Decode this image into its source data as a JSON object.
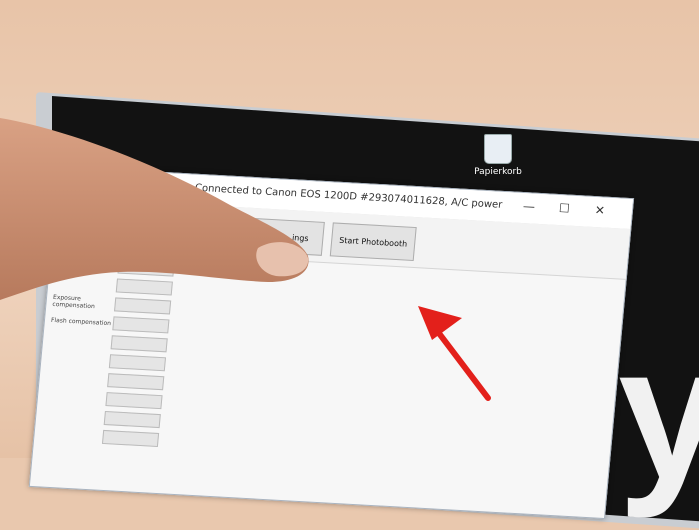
{
  "desktop": {
    "recycle_bin_label": "Papierkorb",
    "wallpaper_letter": "y"
  },
  "window": {
    "title": "…for Windows - Connected to Canon EOS 1200D #293074011628, A/C power",
    "controls": {
      "minimize": "—",
      "maximize": "☐",
      "close": "✕"
    },
    "toolbar": {
      "advanced_settings_label": "…nced …ings",
      "start_button_label": "Start Photobooth"
    },
    "sidebar_rows": [
      {
        "label": "",
        "value": ""
      },
      {
        "label": "",
        "value": ""
      },
      {
        "label": "Exposure compensation",
        "value": ""
      },
      {
        "label": "Flash compensation",
        "value": ""
      },
      {
        "label": "",
        "value": ""
      },
      {
        "label": "",
        "value": ""
      },
      {
        "label": "",
        "value": ""
      },
      {
        "label": "",
        "value": ""
      },
      {
        "label": "",
        "value": ""
      },
      {
        "label": "",
        "value": ""
      }
    ]
  },
  "colors": {
    "arrow": "#e3201b",
    "desktop_bg": "#121212",
    "wall": "#e9c8ae"
  }
}
